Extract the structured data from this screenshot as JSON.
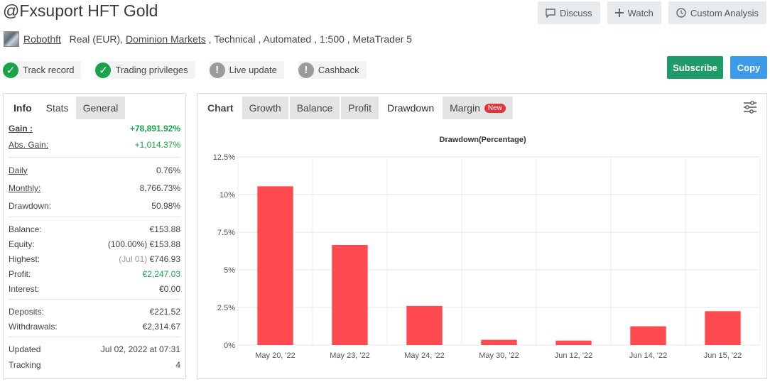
{
  "header": {
    "title": "@Fxsuport HFT Gold",
    "actions": [
      {
        "label": "Discuss",
        "icon": "comment-icon"
      },
      {
        "label": "Watch",
        "icon": "plus-icon"
      },
      {
        "label": "Custom Analysis",
        "icon": "clock-icon"
      }
    ]
  },
  "meta": {
    "author": "Robothft",
    "account": "Real (EUR),",
    "broker": "Dominion Markets",
    "details": " , Technical , Automated , 1:500 , MetaTrader 5"
  },
  "badges": [
    {
      "label": "Track record",
      "status": "ok",
      "icon": "check-icon"
    },
    {
      "label": "Trading privileges",
      "status": "ok",
      "icon": "check-icon"
    },
    {
      "label": "Live update",
      "status": "warn",
      "icon": "exclamation-icon"
    },
    {
      "label": "Cashback",
      "status": "warn",
      "icon": "exclamation-icon"
    }
  ],
  "buttons": {
    "subscribe": "Subscribe",
    "copy": "Copy"
  },
  "left_tabs": [
    "Info",
    "Stats",
    "General"
  ],
  "stats": {
    "gain_label": "Gain :",
    "gain": "+78,891.92%",
    "abs_gain_label": "Abs. Gain:",
    "abs_gain": "+1,014.37%",
    "daily_label": "Daily",
    "daily": "0.76%",
    "monthly_label": "Monthly:",
    "monthly": "8,766.73%",
    "drawdown_label": "Drawdown:",
    "drawdown": "50.98%",
    "balance_label": "Balance:",
    "balance": "€153.88",
    "equity_label": "Equity:",
    "equity_pct": "(100.00%)",
    "equity": "€153.88",
    "highest_label": "Highest:",
    "highest_date": "(Jul 01)",
    "highest": "€746.93",
    "profit_label": "Profit:",
    "profit": "€2,247.03",
    "interest_label": "Interest:",
    "interest": "€0.00",
    "deposits_label": "Deposits:",
    "deposits": "€221.52",
    "withdrawals_label": "Withdrawals:",
    "withdrawals": "€2,314.67",
    "updated_label": "Updated",
    "updated": "Jul 02, 2022 at 07:31",
    "tracking_label": "Tracking",
    "tracking": "4"
  },
  "right_tabs": [
    "Chart",
    "Growth",
    "Balance",
    "Profit",
    "Drawdown",
    "Margin"
  ],
  "new_badge": "New",
  "colors": {
    "bar": "#ff4a50",
    "green": "#1aa34a",
    "subscribe": "#1f9b6a",
    "copy": "#3d9be9"
  },
  "chart_data": {
    "type": "bar",
    "title": "Drawdown(Percentage)",
    "categories": [
      "May 20, '22",
      "May 23, '22",
      "May 24, '22",
      "May 30, '22",
      "Jun 12, '22",
      "Jun 14, '22",
      "Jun 15, '22"
    ],
    "values": [
      10.55,
      6.65,
      2.6,
      0.35,
      0.3,
      1.25,
      2.25
    ],
    "ylim": [
      0,
      12.5
    ],
    "yticks": [
      "0%",
      "2.5%",
      "5%",
      "7.5%",
      "10%",
      "12.5%"
    ],
    "grid": true
  }
}
